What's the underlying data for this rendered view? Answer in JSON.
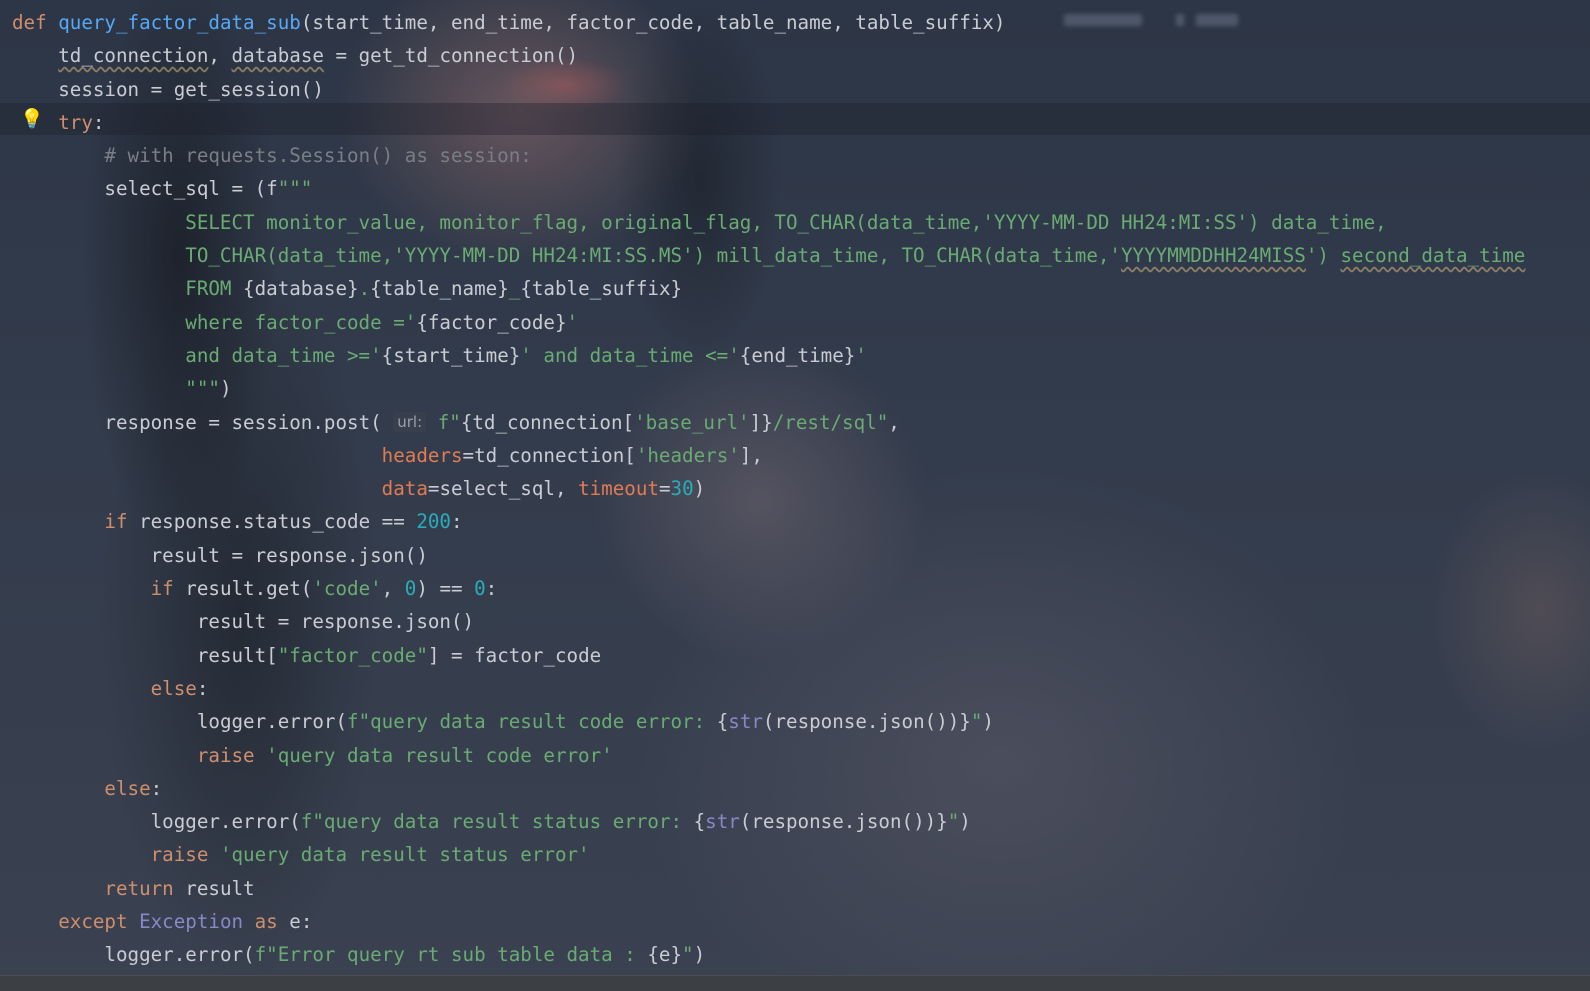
{
  "editor": {
    "language": "python",
    "lightbulb_icon": "lightbulb-icon",
    "parameter_hint": "url:",
    "colors": {
      "keyword": "#cf8e6d",
      "function": "#56a8f5",
      "string": "#6aab73",
      "number": "#2aacb8",
      "comment": "#7a7e85",
      "parameter": "#e07b53",
      "text": "#c9ccd3"
    }
  },
  "code": {
    "l01": {
      "kw": "def",
      "fn": "query_factor_data_sub",
      "rest": "(start_time, end_time, factor_code, table_name, table_suffix)"
    },
    "l02": {
      "a": "td_connection",
      "b": ", ",
      "c": "database",
      "d": " = get_td_connection()"
    },
    "l03": {
      "a": "session = get_session()"
    },
    "l04": {
      "kw": "try",
      "colon": ":"
    },
    "l05": {
      "cmt": "# with requests.Session() as session:"
    },
    "l06": {
      "a": "select_sql = (f",
      "s": "\"\"\""
    },
    "l07": {
      "s": "SELECT monitor_value, monitor_flag, original_flag, TO_CHAR(data_time,'YYYY-MM-DD HH24:MI:SS') data_time,"
    },
    "l08": {
      "s1": "TO_CHAR(data_time,'YYYY-MM-DD HH24:MI:SS.MS') mill_data_time, TO_CHAR(data_time,'",
      "s2": "YYYYMMDDHH24MISS",
      "s3": "') ",
      "s4": "second_data_time"
    },
    "l09": {
      "s1": "FROM ",
      "b1": "{database}",
      "s2": ".",
      "b2": "{table_name}",
      "s3": "_",
      "b3": "{table_suffix}"
    },
    "l10": {
      "s1": "where factor_code ='",
      "b1": "{factor_code}",
      "s2": "'"
    },
    "l11": {
      "s1": "and data_time >='",
      "b1": "{start_time}",
      "s2": "' and data_time <='",
      "b2": "{end_time}",
      "s3": "'"
    },
    "l12": {
      "s": "\"\"\"",
      "a": ")"
    },
    "l13": {
      "a": "response = session.post(",
      "s1": "f\"",
      "b1": "{td_connection[",
      "s2": "'base_url'",
      "b2": "]}",
      "s3": "/rest/sql\"",
      "c": ","
    },
    "l14": {
      "p": "headers",
      "a": "=td_connection[",
      "s": "'headers'",
      "c": "],"
    },
    "l15": {
      "p1": "data",
      "a": "=select_sql, ",
      "p2": "timeout",
      "eq": "=",
      "n": "30",
      "c": ")"
    },
    "l16": {
      "kw": "if",
      "a": " response.status_code == ",
      "n": "200",
      "c": ":"
    },
    "l17": {
      "a": "result = response.json()"
    },
    "l18": {
      "kw": "if",
      "a": " result.get(",
      "s": "'code'",
      "b": ", ",
      "n1": "0",
      "c": ") == ",
      "n2": "0",
      "d": ":"
    },
    "l19": {
      "a": "result = response.json()"
    },
    "l20": {
      "a": "result[",
      "s": "\"factor_code\"",
      "b": "] = factor_code"
    },
    "l21": {
      "kw": "else",
      "c": ":"
    },
    "l22": {
      "a": "logger.error(",
      "s1": "f\"query data result code error: ",
      "b1": "{",
      "bi": "str",
      "b2": "(response.json())}",
      "s2": "\"",
      "c": ")"
    },
    "l23": {
      "kw": "raise",
      "s": " 'query data result code error'"
    },
    "l24": {
      "kw": "else",
      "c": ":"
    },
    "l25": {
      "a": "logger.error(",
      "s1": "f\"query data result status error: ",
      "b1": "{",
      "bi": "str",
      "b2": "(response.json())}",
      "s2": "\"",
      "c": ")"
    },
    "l26": {
      "kw": "raise",
      "s": " 'query data result status error'"
    },
    "l27": {
      "kw": "return",
      "a": " result"
    },
    "l28": {
      "kw1": "except",
      "cls": " Exception",
      "kw2": " as",
      "a": " e:"
    },
    "l29": {
      "a": "logger.error(",
      "s1": "f\"Error query rt sub table data : ",
      "b1": "{e}",
      "s2": "\"",
      "c": ")"
    }
  }
}
